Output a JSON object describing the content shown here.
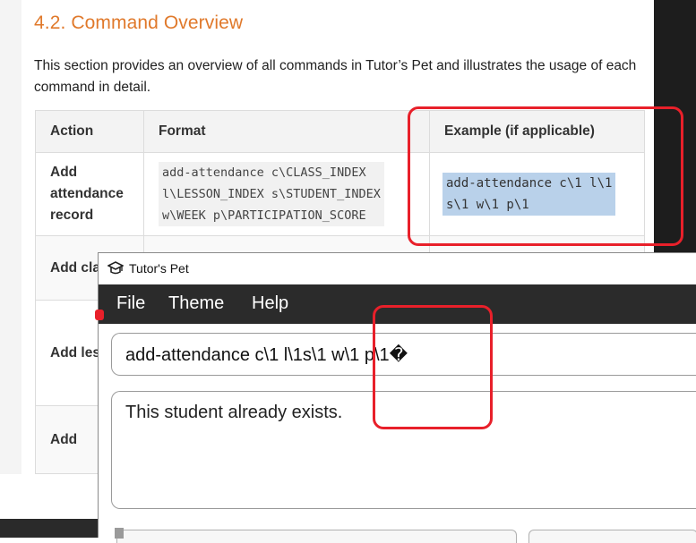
{
  "doc": {
    "section_title": "4.2. Command Overview",
    "intro": "This section provides an overview of all commands in Tutor’s Pet and illustrates the usage of each command in detail.",
    "table": {
      "headers": [
        "Action",
        "Format",
        "Example (if applicable)"
      ],
      "rows": [
        {
          "action_lines": [
            "Add",
            "attendance",
            "record"
          ],
          "format_lines": [
            "add-attendance c\\CLASS_INDEX",
            "l\\LESSON_INDEX s\\STUDENT_INDEX",
            "w\\WEEK p\\PARTICIPATION_SCORE"
          ],
          "example_lines": [
            "add-attendance c\\1 l\\1",
            "s\\1 w\\1 p\\1"
          ]
        },
        {
          "action_partial": "Add cla"
        },
        {
          "action_partial": "Add les"
        },
        {
          "action_partial": "Add"
        }
      ]
    }
  },
  "window": {
    "title": "Tutor's Pet",
    "menu": [
      "File",
      "Theme",
      "Help"
    ],
    "command_input_value": "add-attendance c\\1 l\\1s\\1 w\\1 p\\1�",
    "result_text": "This student already exists."
  },
  "colors": {
    "section_title": "#e0792b",
    "annotation": "#e8202a",
    "menubar": "#2b2b2b",
    "selection": "#b9d1ea"
  },
  "icons": [
    "tutors-pet-app-icon"
  ]
}
